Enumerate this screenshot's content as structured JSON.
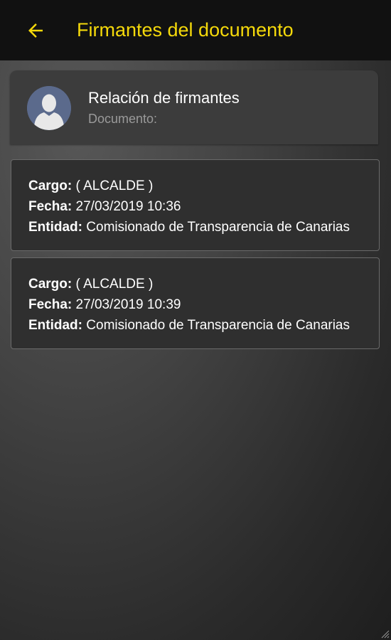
{
  "header": {
    "back_icon": "arrow-left-icon",
    "title": "Firmantes del documento"
  },
  "info": {
    "title": "Relación de firmantes",
    "subtitle": "Documento:"
  },
  "signers": [
    {
      "cargo_label": "Cargo:",
      "cargo": "( ALCALDE )",
      "fecha_label": "Fecha:",
      "fecha": "27/03/2019 10:36",
      "entidad_label": "Entidad:",
      "entidad": "Comisionado de Transparencia de Canarias"
    },
    {
      "cargo_label": "Cargo:",
      "cargo": "( ALCALDE )",
      "fecha_label": "Fecha:",
      "fecha": "27/03/2019 10:39",
      "entidad_label": "Entidad:",
      "entidad": "Comisionado de Transparencia de Canarias"
    }
  ],
  "colors": {
    "accent": "#f5d90a",
    "topbar": "#111111",
    "avatar": "#5b6a8c"
  }
}
